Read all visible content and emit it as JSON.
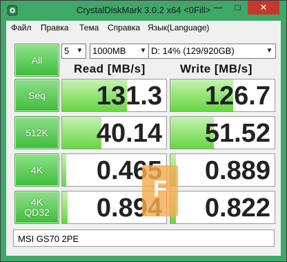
{
  "window": {
    "title": "CrystalDiskMark 3.0.2 x64 <0Fill>",
    "minimize_glyph": "—",
    "maximize_glyph": "□",
    "close_glyph": "✕",
    "icon": "crystaldiskmark-app-icon"
  },
  "menu": {
    "items": [
      {
        "label": "Файл"
      },
      {
        "label": "Правка"
      },
      {
        "label": "Тема"
      },
      {
        "label": "Справка"
      },
      {
        "label": "Язык(Language)"
      }
    ]
  },
  "controls": {
    "all_label": "All",
    "count_value": "5",
    "size_value": "1000MB",
    "drive_value": "D: 14% (129/920GB)"
  },
  "headers": {
    "read": "Read [MB/s]",
    "write": "Write [MB/s]"
  },
  "tests": [
    {
      "label_line1": "Seq",
      "label_line2": "",
      "read": "131.3",
      "write": "126.7",
      "read_fill": 0.62,
      "write_fill": 0.6
    },
    {
      "label_line1": "512K",
      "label_line2": "",
      "read": "40.14",
      "write": "51.52",
      "read_fill": 0.38,
      "write_fill": 0.42
    },
    {
      "label_line1": "4K",
      "label_line2": "",
      "read": "0.465",
      "write": "0.889",
      "read_fill": 0.04,
      "write_fill": 0.05
    },
    {
      "label_line1": "4K",
      "label_line2": "QD32",
      "read": "0.894",
      "write": "0.822",
      "read_fill": 0.05,
      "write_fill": 0.05
    }
  ],
  "comment": "MSI GS70 2PE",
  "watermark_letter": "F",
  "colors": {
    "titlebar": "#3fa868",
    "bar_fill": "#66d63f",
    "button_green": "#3fbd39",
    "watermark": "#f5ad52"
  }
}
